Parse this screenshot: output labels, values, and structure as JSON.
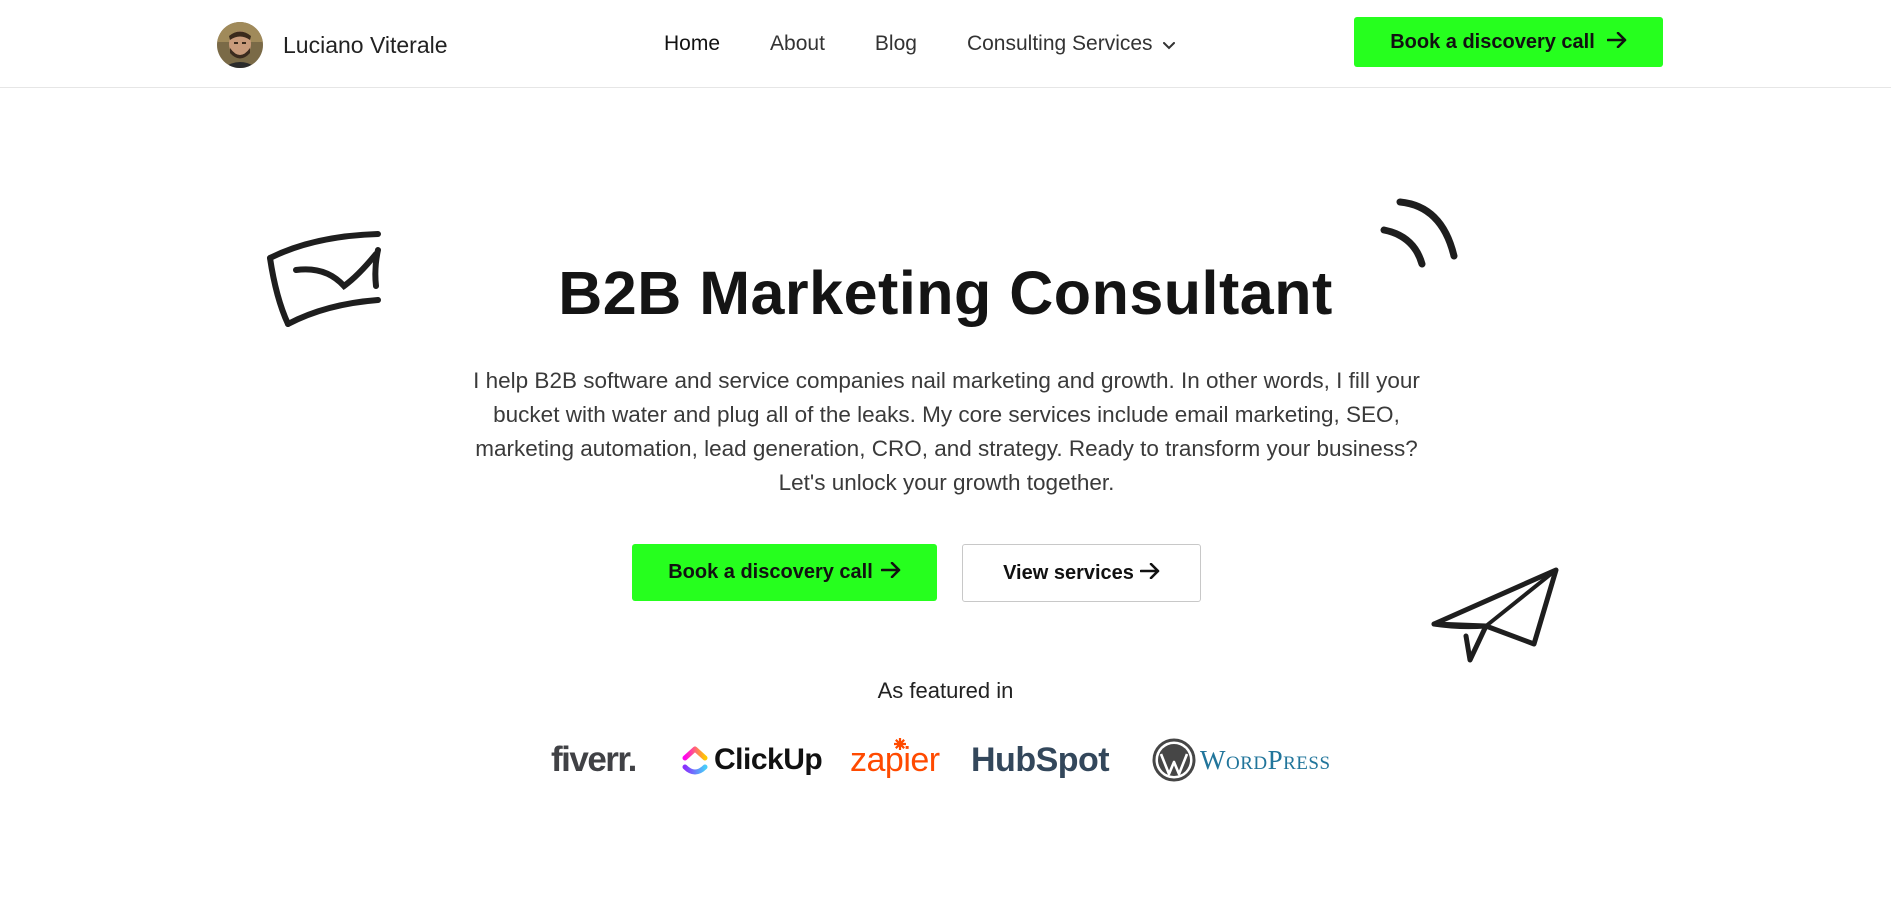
{
  "header": {
    "brand_name": "Luciano Viterale",
    "nav": [
      "Home",
      "About",
      "Blog",
      "Consulting Services"
    ],
    "cta_label": "Book a discovery call"
  },
  "hero": {
    "title": "B2B Marketing Consultant",
    "description": "I help B2B software and service companies nail marketing and growth. In other words, I fill your bucket with water and plug all of the leaks. My core services include email marketing, SEO, marketing automation, lead generation, CRO, and strategy. Ready to transform your business? Let's unlock your growth together.",
    "primary_cta": "Book a discovery call",
    "secondary_cta": "View services"
  },
  "featured": {
    "label": "As featured in",
    "logos": [
      "fiverr.",
      "ClickUp",
      "zapier",
      "HubSpot",
      "WordPress"
    ]
  },
  "colors": {
    "accent_green": "#26ff1e",
    "zapier_orange": "#ff4a00",
    "hubspot_navy": "#33475b",
    "hubspot_orange": "#ff7a59",
    "wordpress_blue": "#21759b"
  },
  "icons": [
    "avatar-photo",
    "chevron-down-icon",
    "arrow-right-icon",
    "envelope-doodle",
    "signal-doodle",
    "paper-plane-doodle"
  ]
}
